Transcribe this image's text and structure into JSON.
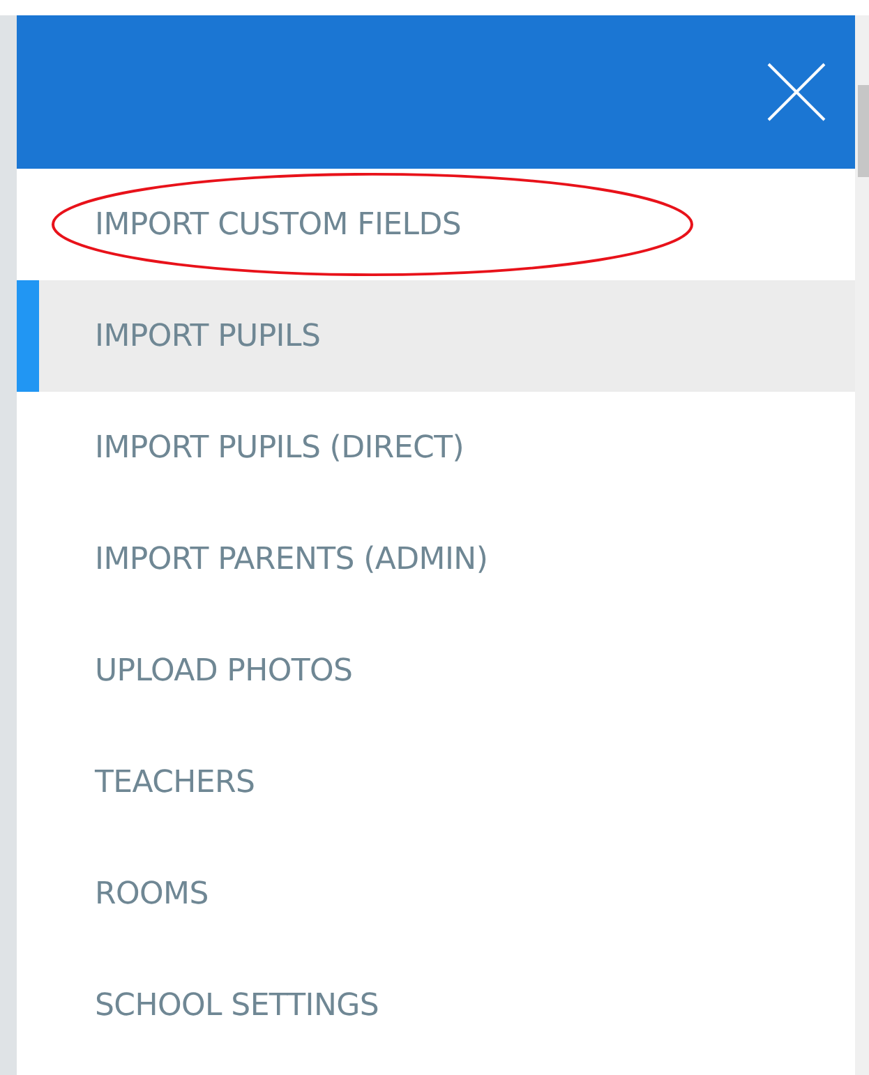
{
  "menu_items": [
    {
      "label": "IMPORT CUSTOM FIELDS",
      "selected": false,
      "circled": true
    },
    {
      "label": "IMPORT PUPILS",
      "selected": true,
      "circled": false
    },
    {
      "label": "IMPORT PUPILS (DIRECT)",
      "selected": false,
      "circled": false
    },
    {
      "label": "IMPORT PARENTS (ADMIN)",
      "selected": false,
      "circled": false
    },
    {
      "label": "UPLOAD PHOTOS",
      "selected": false,
      "circled": false
    },
    {
      "label": "TEACHERS",
      "selected": false,
      "circled": false
    },
    {
      "label": "ROOMS",
      "selected": false,
      "circled": false
    },
    {
      "label": "SCHOOL SETTINGS",
      "selected": false,
      "circled": false
    }
  ]
}
